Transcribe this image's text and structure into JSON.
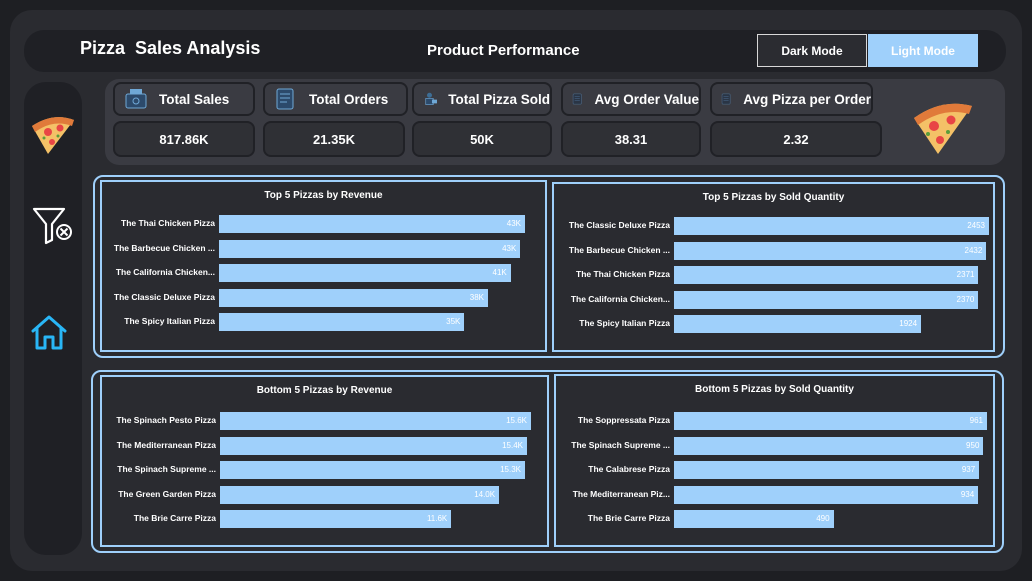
{
  "header": {
    "title": "Pizza  Sales Analysis",
    "subtitle": "Product Performance",
    "dark_mode_label": "Dark Mode",
    "light_mode_label": "Light Mode"
  },
  "sidebar": {
    "items": [
      {
        "icon": "pizza-icon"
      },
      {
        "icon": "clear-filter-icon"
      },
      {
        "icon": "home-icon"
      }
    ]
  },
  "kpis": [
    {
      "label": "Total Sales",
      "value": "817.86K",
      "icon": "money-icon"
    },
    {
      "label": "Total Orders",
      "value": "21.35K",
      "icon": "order-list-icon"
    },
    {
      "label": "Total Pizza Sold",
      "value": "50K",
      "icon": "delivery-icon"
    },
    {
      "label": "Avg Order Value",
      "value": "38.31",
      "icon": "checklist-icon"
    },
    {
      "label": "Avg Pizza per Order",
      "value": "2.32",
      "icon": "checklist-icon"
    }
  ],
  "colors": {
    "accent": "#9fd0fb",
    "background": "#2a2b30",
    "panel_dark": "#1f2025"
  },
  "chart_data": [
    {
      "type": "bar",
      "title": "Top 5 Pizzas by Revenue",
      "categories": [
        "The Thai Chicken Pizza",
        "The Barbecue Chicken ...",
        "The California Chicken...",
        "The Classic Deluxe Pizza",
        "The Spicy Italian Pizza"
      ],
      "values": [
        43434,
        42768,
        41410,
        38180,
        34831
      ],
      "value_labels": [
        "43K",
        "43K",
        "41K",
        "38K",
        "35K"
      ],
      "xlim": [
        0,
        50000
      ]
    },
    {
      "type": "bar",
      "title": "Top 5 Pizzas by Sold Quantity",
      "categories": [
        "The Classic Deluxe Pizza",
        "The Barbecue Chicken ...",
        "The Thai Chicken Pizza",
        "The California Chicken...",
        "The Spicy Italian Pizza"
      ],
      "values": [
        2453,
        2432,
        2371,
        2370,
        1924
      ],
      "value_labels": [
        "2453",
        "2432",
        "2371",
        "2370",
        "1924"
      ],
      "xlim": [
        0,
        2800
      ]
    },
    {
      "type": "bar",
      "title": "Bottom 5 Pizzas by Revenue",
      "categories": [
        "The Spinach Pesto Pizza",
        "The Mediterranean Pizza",
        "The Spinach Supreme ...",
        "The Green Garden Pizza",
        "The Brie Carre Pizza"
      ],
      "values": [
        15600,
        15400,
        15300,
        14000,
        11600
      ],
      "value_labels": [
        "15.6K",
        "15.4K",
        "15.3K",
        "14.0K",
        "11.6K"
      ],
      "xlim": [
        0,
        18000
      ]
    },
    {
      "type": "bar",
      "title": "Bottom 5 Pizzas by Sold Quantity",
      "categories": [
        "The Soppressata Pizza",
        "The Spinach Supreme ...",
        "The Calabrese Pizza",
        "The Mediterranean Piz...",
        "The Brie Carre Pizza"
      ],
      "values": [
        961,
        950,
        937,
        934,
        490
      ],
      "value_labels": [
        "961",
        "950",
        "937",
        "934",
        "490"
      ],
      "xlim": [
        0,
        1100
      ]
    }
  ]
}
